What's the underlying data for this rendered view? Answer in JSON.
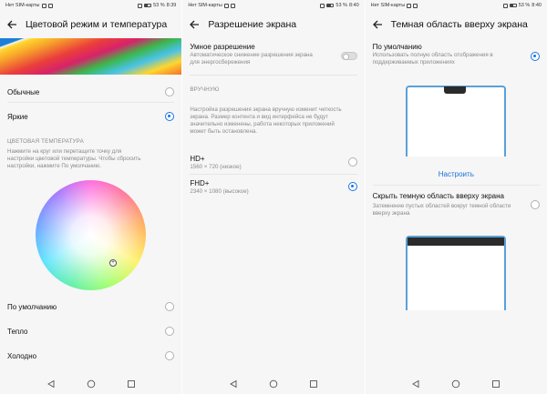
{
  "status": {
    "no_sim": "Нет SIM-карты",
    "battery": "53 %",
    "time1": "8:39",
    "time2": "8:40",
    "time3": "8:40"
  },
  "screen1": {
    "title": "Цветовой режим и температура",
    "modes": [
      {
        "label": "Обычные",
        "selected": false
      },
      {
        "label": "Яркие",
        "selected": true
      }
    ],
    "section": "ЦВЕТОВАЯ ТЕМПЕРАТУРА",
    "hint": "Нажмите на круг или перетащите точку для настройки цветовой температуры. Чтобы сбросить настройки, нажмите По умолчанию.",
    "temps": [
      {
        "label": "По умолчанию",
        "selected": false
      },
      {
        "label": "Тепло",
        "selected": false
      },
      {
        "label": "Холодно",
        "selected": false
      }
    ]
  },
  "screen2": {
    "title": "Разрешение экрана",
    "smart_label": "Умное разрешение",
    "smart_sub": "Автоматическое снижение разрешения экрана для энергосбережения",
    "smart_on": false,
    "section": "ВРУЧНУЮ",
    "hint": "Настройка разрешения экрана вручную изменит четкость экрана. Размер контента и вид интерфейса не будут значительно изменены, работа некоторых приложений может быть остановлена.",
    "options": [
      {
        "label": "HD+",
        "sub": "1560 × 720 (низкое)",
        "selected": false
      },
      {
        "label": "FHD+",
        "sub": "2340 × 1080 (высокое)",
        "selected": true
      }
    ]
  },
  "screen3": {
    "title": "Темная область вверху экрана",
    "options": [
      {
        "label": "По умолчанию",
        "sub": "Использовать полную область отображения в поддерживаемых приложениях",
        "selected": true
      },
      {
        "label": "Скрыть темную область вверху экрана",
        "sub": "Затемнение пустых областей вокруг темной области вверху экрана",
        "selected": false
      }
    ],
    "configure": "Настроить"
  },
  "colors": {
    "accent": "#1a73e8",
    "phone_frame": "#5aa1d8",
    "notch": "#2b2b2b"
  }
}
